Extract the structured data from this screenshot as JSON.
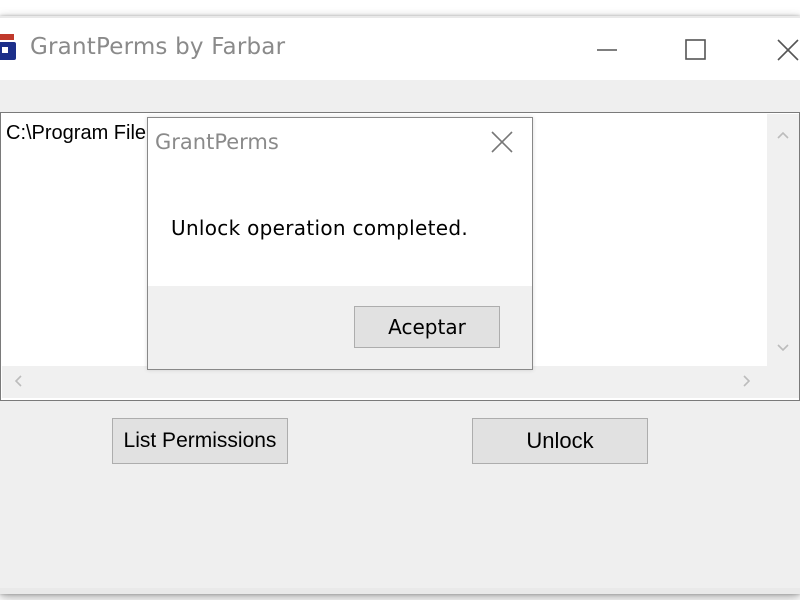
{
  "window": {
    "title": "GrantPerms by Farbar"
  },
  "titlebar_icons": {
    "app": "app-lock-icon",
    "minimize": "minimize-icon",
    "maximize": "maximize-icon",
    "close": "close-icon"
  },
  "listbox": {
    "items": [
      "C:\\Program File"
    ]
  },
  "buttons": {
    "list_permissions": "List Permissions",
    "unlock": "Unlock"
  },
  "dialog": {
    "title": "GrantPerms",
    "message": "Unlock operation completed.",
    "ok_label": "Aceptar"
  },
  "colors": {
    "accent_icon": "#1c2f8a",
    "icon_red": "#c0392b"
  }
}
